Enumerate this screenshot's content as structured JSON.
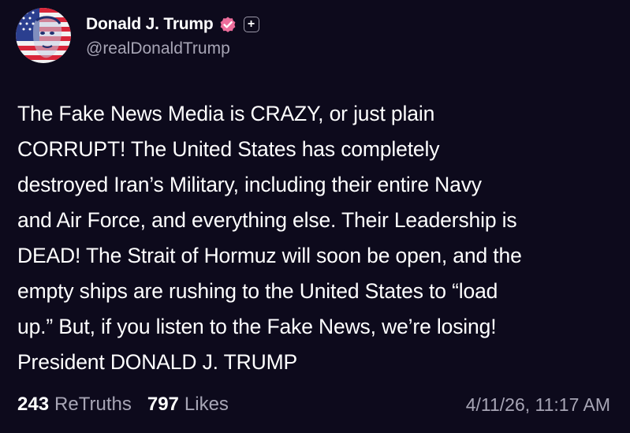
{
  "account": {
    "display_name": "Donald J. Trump",
    "handle": "@realDonaldTrump",
    "verified_color": "#ec6d9b",
    "follow_icon": "plus-icon"
  },
  "post": {
    "lines": [
      "The Fake News Media is CRAZY, or just plain",
      "CORRUPT! The United States has completely",
      "destroyed Iran’s Military, including their entire Navy",
      "and Air Force, and everything else. Their Leadership is",
      "DEAD! The Strait of Hormuz will soon be open, and the",
      "empty ships are rushing to the United States to “load",
      "up.” But, if you listen to the Fake News, we’re losing!",
      "President DONALD J. TRUMP"
    ]
  },
  "stats": {
    "retruths_count": "243",
    "retruths_label": "ReTruths",
    "likes_count": "797",
    "likes_label": "Likes"
  },
  "timestamp": "4/11/26, 11:17 AM",
  "colors": {
    "background": "#0d0a1c",
    "text": "#ffffff",
    "muted": "#a7a5b5"
  }
}
